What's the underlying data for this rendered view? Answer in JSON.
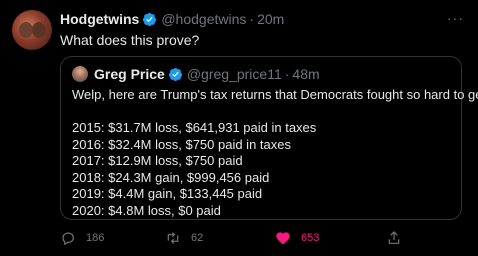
{
  "tweet": {
    "author_name": "Hodgetwins",
    "author_handle": "@hodgetwins",
    "separator": "·",
    "time": "20m",
    "more_label": "···",
    "text": "What does this prove?",
    "verified_icon": "verified-badge-icon"
  },
  "quote": {
    "author_name": "Greg Price",
    "author_handle": "@greg_price11",
    "separator": "·",
    "time": "48m",
    "lines": [
      "Welp, here are Trump's tax returns that Democrats fought so hard to get:",
      "",
      "2015: $31.7M loss, $641,931 paid in taxes",
      "2016: $32.4M loss, $750 paid in taxes",
      "2017: $12.9M loss, $750 paid",
      "2018: $24.3M gain, $999,456 paid",
      "2019: $4.4M gain, $133,445 paid",
      "2020: $4.8M loss, $0 paid"
    ]
  },
  "actions": {
    "replies": "186",
    "retweets": "62",
    "likes": "653"
  },
  "colors": {
    "background": "#000000",
    "text": "#e7e9ea",
    "muted": "#71767b",
    "verified": "#1d9bf0",
    "like": "#f91880",
    "border": "#2f3336"
  }
}
